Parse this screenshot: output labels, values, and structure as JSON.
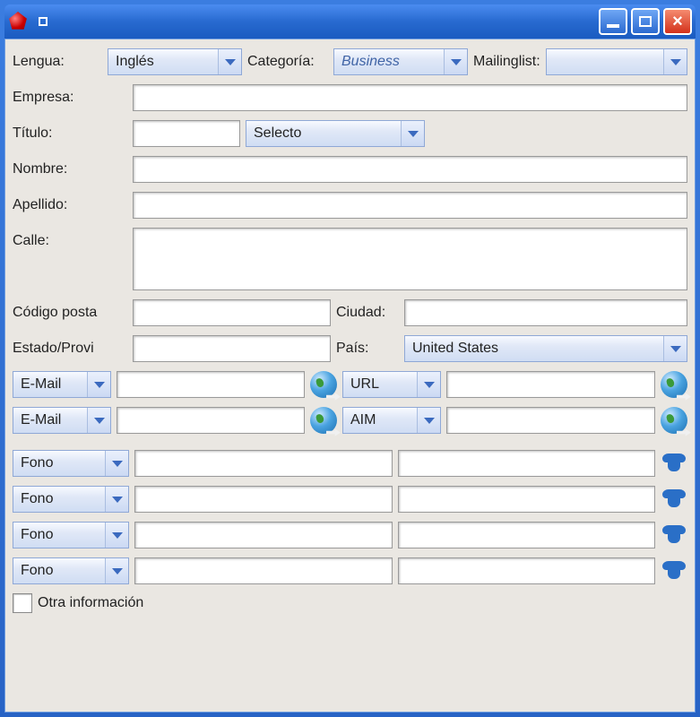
{
  "titlebar": {
    "title": ""
  },
  "labels": {
    "language": "Lengua:",
    "category": "Categoría:",
    "mailinglist": "Mailinglist:",
    "company": "Empresa:",
    "title": "Título:",
    "name": "Nombre:",
    "lastname": "Apellido:",
    "street": "Calle:",
    "postalcode": "Código posta",
    "city": "Ciudad:",
    "state": "Estado/Provi",
    "country": "País:",
    "otherinfo": "Otra información"
  },
  "values": {
    "language": "Inglés",
    "category": "Business",
    "mailinglist": "",
    "company": "",
    "title": "",
    "salutation": "Selecto",
    "name": "",
    "lastname": "",
    "street": "",
    "postalcode": "",
    "city": "",
    "state": "",
    "country": "United States",
    "contact1_type": "E-Mail",
    "contact1_value": "",
    "contact1b_type": "URL",
    "contact1b_value": "",
    "contact2_type": "E-Mail",
    "contact2_value": "",
    "contact2b_type": "AIM",
    "contact2b_value": "",
    "phone1_type": "Fono",
    "phone1_value": "",
    "phone1b_value": "",
    "phone2_type": "Fono",
    "phone2_value": "",
    "phone2b_value": "",
    "phone3_type": "Fono",
    "phone3_value": "",
    "phone3b_value": "",
    "phone4_type": "Fono",
    "phone4_value": "",
    "phone4b_value": ""
  }
}
